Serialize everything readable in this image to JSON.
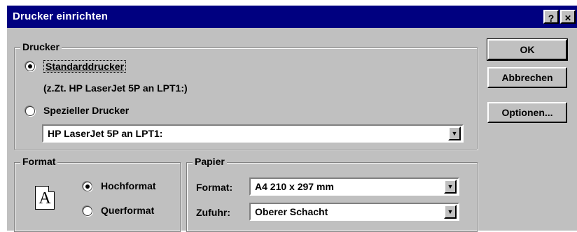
{
  "window": {
    "title": "Drucker einrichten",
    "help_label": "?",
    "close_label": "✕"
  },
  "drucker": {
    "legend": "Drucker",
    "standard_label": "Standarddrucker",
    "current_printer": "(z.Zt. HP LaserJet 5P an LPT1:)",
    "special_label": "Spezieller Drucker",
    "special_value": "HP LaserJet 5P an LPT1:",
    "selected": "standard"
  },
  "format": {
    "legend": "Format",
    "portrait_label": "Hochformat",
    "landscape_label": "Querformat",
    "selected": "portrait",
    "icon_letter": "A"
  },
  "papier": {
    "legend": "Papier",
    "format_label": "Format:",
    "format_value": "A4 210 x 297 mm",
    "zufuhr_label": "Zufuhr:",
    "zufuhr_value": "Oberer Schacht"
  },
  "buttons": {
    "ok": "OK",
    "cancel": "Abbrechen",
    "options": "Optionen..."
  },
  "icons": {
    "dropdown": "▼"
  }
}
